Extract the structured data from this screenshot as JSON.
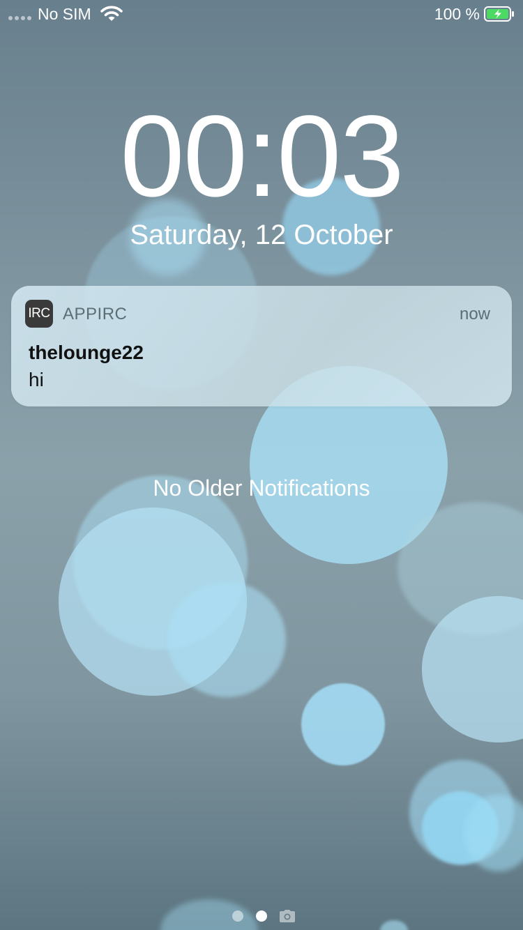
{
  "status_bar": {
    "carrier": "No SIM",
    "battery_percent": "100 %",
    "signal_icon": "signal-dots-icon",
    "wifi_icon": "wifi-icon",
    "battery_icon": "battery-charging-icon",
    "battery_level": 1.0,
    "battery_color": "#4cd964"
  },
  "lock_screen": {
    "time": "00:03",
    "date": "Saturday, 12 October"
  },
  "notification": {
    "app_icon_text": "IRC",
    "app_name": "APPIRC",
    "time": "now",
    "title": "thelounge22",
    "body": "hi"
  },
  "no_older_label": "No Older Notifications",
  "page_indicator": {
    "pages": 2,
    "current": 2,
    "camera_icon": "camera-icon"
  }
}
